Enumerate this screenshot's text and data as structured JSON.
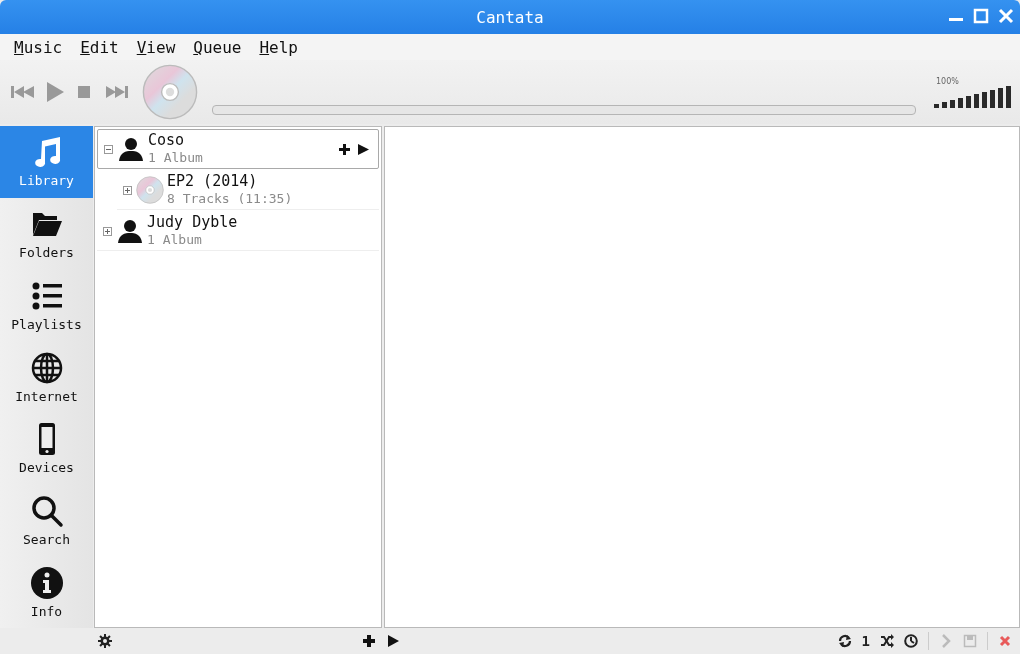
{
  "window": {
    "title": "Cantata"
  },
  "menu": [
    {
      "label": "Music"
    },
    {
      "label": "Edit"
    },
    {
      "label": "View"
    },
    {
      "label": "Queue"
    },
    {
      "label": "Help"
    }
  ],
  "player": {
    "progress": {
      "level": 0
    },
    "volume": {
      "reading": "100%",
      "level": 1
    }
  },
  "sidebar": {
    "items": [
      {
        "label": "Library",
        "kind": "music",
        "selected": true
      },
      {
        "label": "Folders",
        "kind": "folder",
        "selected": false
      },
      {
        "label": "Playlists",
        "kind": "list",
        "selected": false
      },
      {
        "label": "Internet",
        "kind": "globe",
        "selected": false
      },
      {
        "label": "Devices",
        "kind": "phone",
        "selected": false
      },
      {
        "label": "Search",
        "kind": "search",
        "selected": false
      },
      {
        "label": "Info",
        "kind": "info",
        "selected": false
      }
    ]
  },
  "library": {
    "items": [
      {
        "kind": "artist",
        "title": "Coso",
        "subtitle": "1 Album",
        "expanded": true,
        "selected": true,
        "children": [
          {
            "kind": "album",
            "title": "EP2 (2014)",
            "subtitle": "8 Tracks (11:35)",
            "expanded": false,
            "selected": false
          }
        ]
      },
      {
        "kind": "artist",
        "title": "Judy Dyble",
        "subtitle": "1 Album",
        "expanded": false,
        "selected": false
      }
    ]
  },
  "status_bar": {
    "single_label": "1"
  }
}
